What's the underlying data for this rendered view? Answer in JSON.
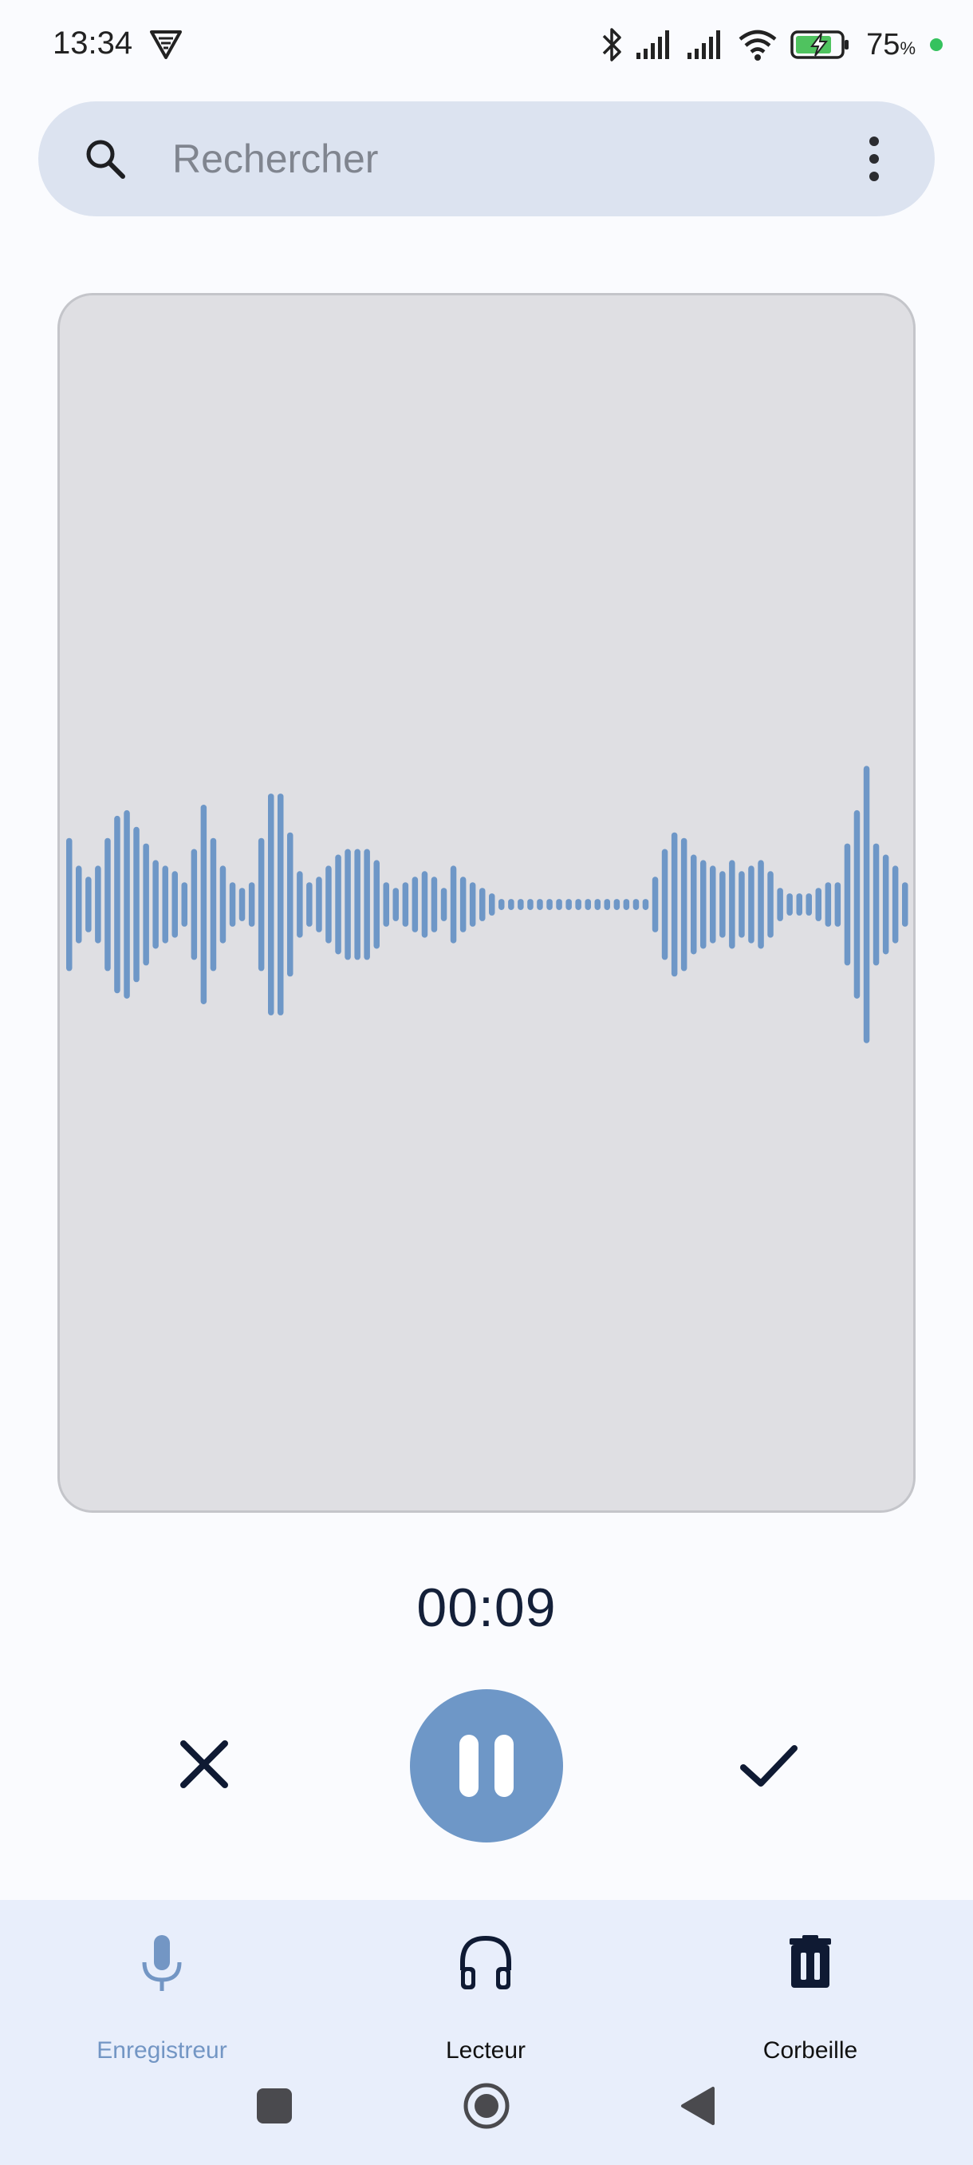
{
  "status_bar": {
    "time": "13:34",
    "battery_percent": "75",
    "battery_unit": "%",
    "icons": [
      "app-notification-icon",
      "bluetooth-icon",
      "signal-icon",
      "signal-icon",
      "wifi-icon",
      "battery-charging-icon"
    ]
  },
  "search": {
    "placeholder": "Rechercher",
    "value": ""
  },
  "recorder": {
    "elapsed_time": "00:09",
    "state": "recording",
    "waveform_levels": [
      0.24,
      0.14,
      0.1,
      0.14,
      0.24,
      0.32,
      0.34,
      0.28,
      0.22,
      0.16,
      0.14,
      0.12,
      0.08,
      0.2,
      0.36,
      0.24,
      0.14,
      0.08,
      0.06,
      0.08,
      0.24,
      0.4,
      0.4,
      0.26,
      0.12,
      0.08,
      0.1,
      0.14,
      0.18,
      0.2,
      0.2,
      0.2,
      0.16,
      0.08,
      0.06,
      0.08,
      0.1,
      0.12,
      0.1,
      0.06,
      0.14,
      0.1,
      0.08,
      0.06,
      0.04,
      0.02,
      0.02,
      0.02,
      0.02,
      0.02,
      0.02,
      0.02,
      0.02,
      0.02,
      0.02,
      0.02,
      0.02,
      0.02,
      0.02,
      0.02,
      0.02,
      0.1,
      0.2,
      0.26,
      0.24,
      0.18,
      0.16,
      0.14,
      0.12,
      0.16,
      0.12,
      0.14,
      0.16,
      0.12,
      0.06,
      0.04,
      0.04,
      0.04,
      0.06,
      0.08,
      0.08,
      0.22,
      0.34,
      0.5,
      0.22,
      0.18,
      0.14,
      0.08
    ],
    "accent_color": "#6e97c7"
  },
  "controls": {
    "cancel": "close-icon",
    "pause": "pause-icon",
    "confirm": "check-icon"
  },
  "bottom_nav": {
    "items": [
      {
        "label": "Enregistreur",
        "icon": "microphone-icon",
        "active": true
      },
      {
        "label": "Lecteur",
        "icon": "headphones-icon",
        "active": false
      },
      {
        "label": "Corbeille",
        "icon": "trash-icon",
        "active": false
      }
    ]
  }
}
